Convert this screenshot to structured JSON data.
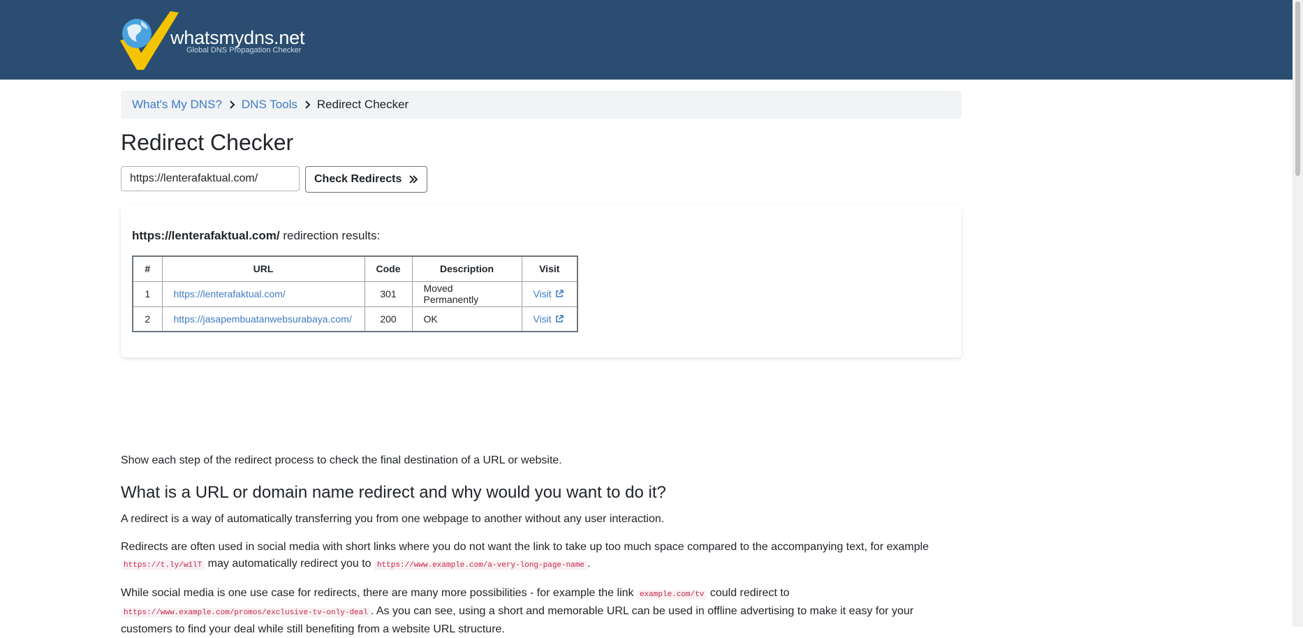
{
  "brand": {
    "name": "whatsmydns.net",
    "tagline": "Global DNS Propagation Checker",
    "colors": {
      "header_bg": "#2a4d71",
      "logo_check": "#f5c400",
      "logo_globe": "#4aa3df",
      "link": "#3f7cc2"
    }
  },
  "breadcrumb": {
    "items": [
      {
        "label": "What's My DNS?"
      },
      {
        "label": "DNS Tools"
      }
    ],
    "current": "Redirect Checker",
    "separator_icon": "chevron-right-icon"
  },
  "page": {
    "title": "Redirect Checker"
  },
  "form": {
    "url_value": "https://lenterafaktual.com/",
    "button_label": "Check Redirects",
    "button_icon": "double-chevron-right-icon"
  },
  "results": {
    "queried_url": "https://lenterafaktual.com/",
    "suffix": " redirection results:",
    "columns": {
      "num": "#",
      "url": "URL",
      "code": "Code",
      "description": "Description",
      "visit": "Visit"
    },
    "rows": [
      {
        "num": "1",
        "url": "https://lenterafaktual.com/",
        "code": "301",
        "description": "Moved Permanently",
        "visit": "Visit"
      },
      {
        "num": "2",
        "url": "https://jasapembuatanwebsurabaya.com/",
        "code": "200",
        "description": "OK",
        "visit": "Visit"
      }
    ],
    "visit_icon": "external-link-icon"
  },
  "content": {
    "intro": "Show each step of the redirect process to check the final destination of a URL or website.",
    "heading": "What is a URL or domain name redirect and why would you want to do it?",
    "p1": "A redirect is a way of automatically transferring you from one webpage to another without any user interaction.",
    "p2": {
      "before": "Redirects are often used in social media with short links where you do not want the link to take up too much space compared to the accompanying text, for example ",
      "code1": "https://t.ly/w1lT",
      "middle": " may automatically redirect you to ",
      "code2": "https://www.example.com/a-very-long-page-name",
      "after": "."
    },
    "p3": {
      "before": "While social media is one use case for redirects, there are many more possibilities - for example the link ",
      "code1": "example.com/tv",
      "middle": " could redirect to ",
      "code2": "https://www.example.com/promos/exclusive-tv-only-deal",
      "after": ". As you can see, using a short and memorable URL can be used in offline advertising to make it easy for your customers to find your deal while still benefiting from a website URL structure."
    }
  }
}
